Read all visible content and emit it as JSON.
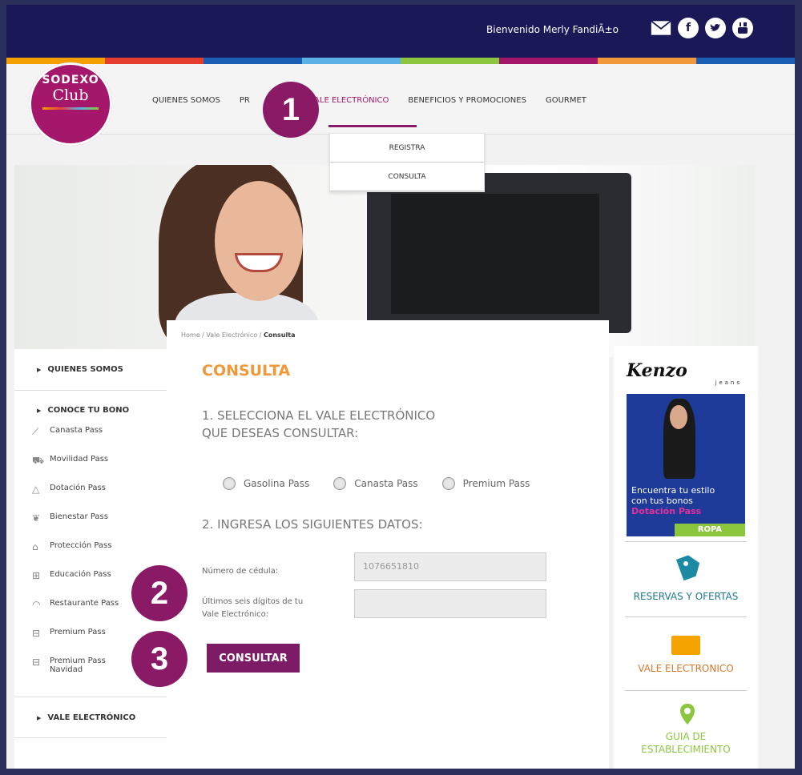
{
  "header": {
    "welcome": "Bienvenido Merly FandiÃ±o",
    "social_icons": [
      "mail-icon",
      "facebook-icon",
      "twitter-icon",
      "youtube-icon"
    ],
    "strip_colors": [
      "#f3a000",
      "#e53e2f",
      "#1b5fb4",
      "#5bb1e6",
      "#8cc63f",
      "#a4176a",
      "#f0983a",
      "#1b1858"
    ]
  },
  "logo": {
    "line1": "SODEXO",
    "line2": "Club"
  },
  "nav": {
    "items": [
      "QUIENES SOMOS",
      "PR",
      "VALE ELECTRÓNICO",
      "BENEFICIOS Y PROMOCIONES",
      "GOURMET"
    ],
    "active_color": "#a4176a",
    "dropdown": [
      "REGISTRA",
      "CONSULTA"
    ]
  },
  "badges": [
    "1",
    "2",
    "3"
  ],
  "breadcrumb": {
    "home": "Home /",
    "section": "Vale Electrónico /",
    "current": "Consulta"
  },
  "form": {
    "title": "CONSULTA",
    "step1": "1. SELECCIONA EL VALE ELECTRÓNICO QUE DESEAS CONSULTAR:",
    "options": [
      "Gasolina Pass",
      "Canasta Pass",
      "Premium Pass"
    ],
    "step2": "2. INGRESA LOS SIGUIENTES DATOS:",
    "cedula_label": "Número de cédula:",
    "cedula_value": "1076651810",
    "digits_label_1": "Últimos seis dígitos de tu",
    "digits_label_2": "Vale Electrónico:",
    "digits_value": "",
    "submit": "CONSULTAR",
    "accent": "#7c1b66",
    "title_color": "#f0983a"
  },
  "sidebar": {
    "heading1": "QUIENES SOMOS",
    "heading2": "CONOCE TU BONO",
    "items": [
      {
        "label": "Canasta Pass",
        "icon": "leaf-icon"
      },
      {
        "label": "Movilidad Pass",
        "icon": "car-icon"
      },
      {
        "label": "Dotación Pass",
        "icon": "hanger-icon"
      },
      {
        "label": "Bienestar Pass",
        "icon": "wellness-icon"
      },
      {
        "label": "Protección Pass",
        "icon": "house-icon"
      },
      {
        "label": "Educación Pass",
        "icon": "book-icon"
      },
      {
        "label": "Restaurante Pass",
        "icon": "dish-icon"
      },
      {
        "label": "Premium Pass",
        "icon": "gift-icon"
      },
      {
        "label": "Premium Pass",
        "label2": "Navidad",
        "icon": "gift-icon"
      }
    ],
    "heading3": "VALE ELECTRÓNICO"
  },
  "ad": {
    "brand": "Kenzo",
    "brand_sub": "jeans",
    "line1": "Encuentra tu estilo",
    "line2": "con tus bonos",
    "line3": "Dotación Pass",
    "tag": "ROPA"
  },
  "right_links": {
    "reservas": "RESERVAS Y OFERTAS",
    "vale": "VALE ELECTRONICO",
    "guia1": "GUIA DE",
    "guia2": "ESTABLECIMIENTO"
  }
}
